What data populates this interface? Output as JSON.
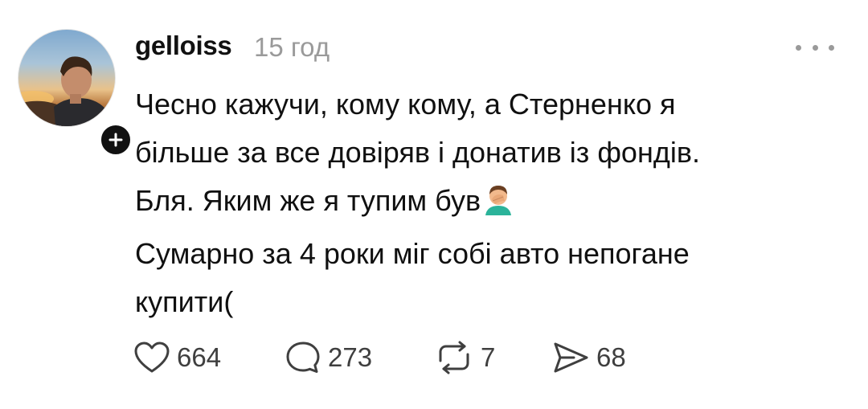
{
  "post": {
    "username": "gelloiss",
    "timestamp": "15 год",
    "lines": [
      "Чесно кажучи, кому кому, а Стерненко я",
      "більше за все довіряв і донатив із фондів.",
      "Бля. Яким же я тупим був",
      "Сумарно за 4 роки міг собі авто непогане",
      "купити("
    ],
    "emoji": "man-facepalming"
  },
  "actions": {
    "likes": "664",
    "replies": "273",
    "reposts": "7",
    "shares": "68"
  },
  "icons": {
    "like": "heart-icon",
    "reply": "comment-bubble-icon",
    "repost": "repost-arrows-icon",
    "share": "send-icon",
    "more": "more-dots-icon",
    "follow": "plus-icon"
  },
  "colors": {
    "text": "#101010",
    "muted": "#9a9a9a",
    "count": "#3f3f3f",
    "badge": "#111111"
  }
}
